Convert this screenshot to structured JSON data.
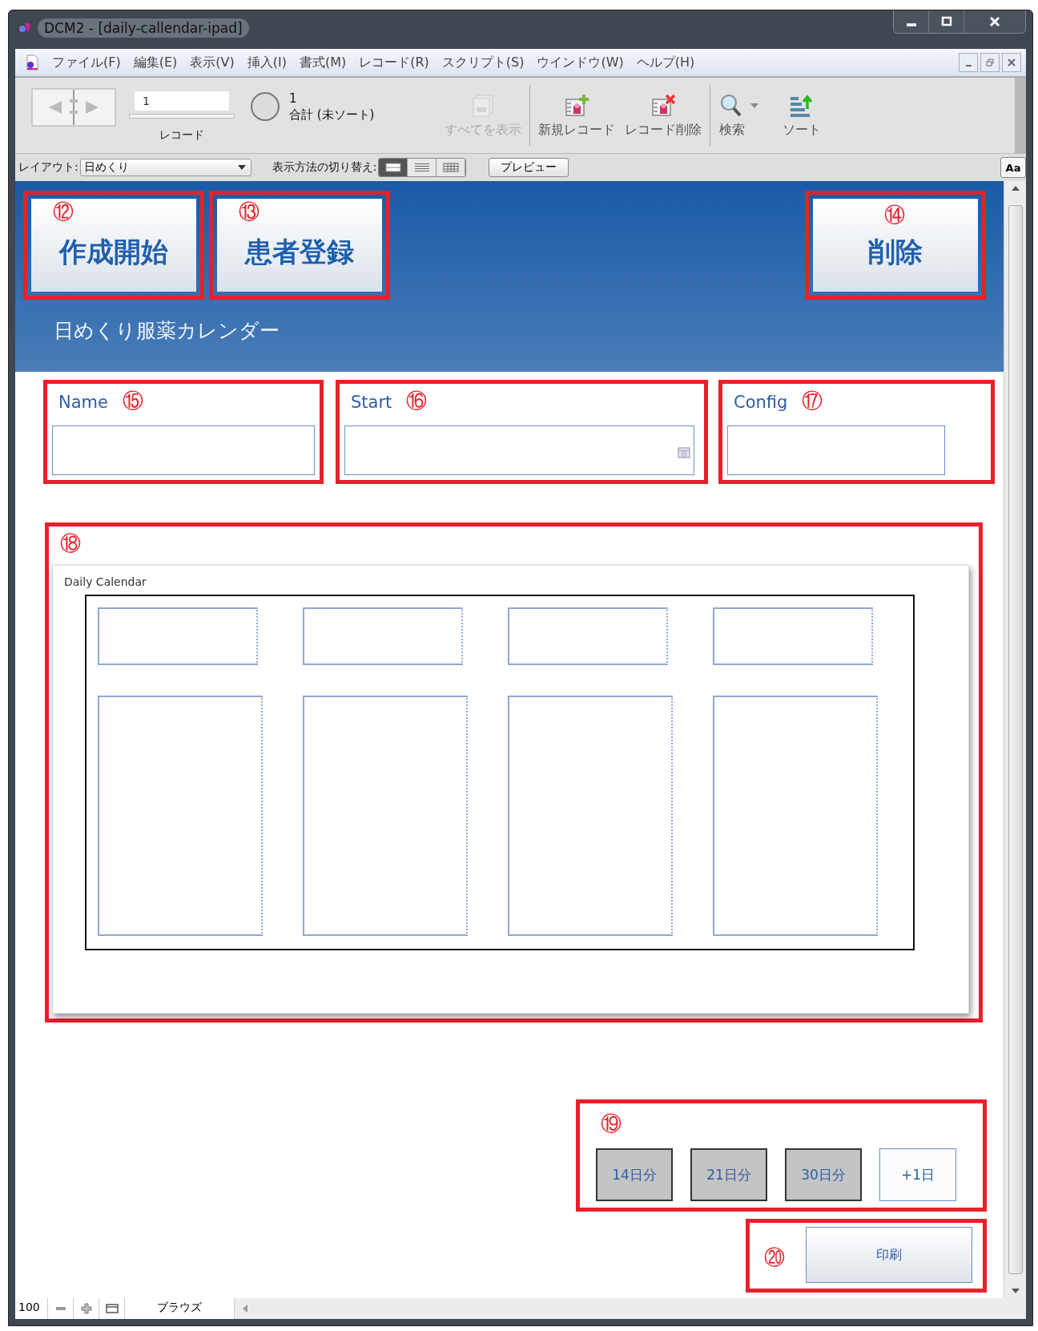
{
  "window": {
    "title": "DCM2 - [daily-callendar-ipad]"
  },
  "menu": [
    "ファイル(F)",
    "編集(E)",
    "表示(V)",
    "挿入(I)",
    "書式(M)",
    "レコード(R)",
    "スクリプト(S)",
    "ウインドウ(W)",
    "ヘルプ(H)"
  ],
  "toolbar": {
    "record_value": "1",
    "record_label": "レコード",
    "found": "1",
    "total_label": "合計 (未ソート)",
    "buttons": [
      {
        "label": "すべてを表示",
        "kind": "showall",
        "disabled": true
      },
      {
        "label": "新規レコード",
        "kind": "new",
        "disabled": false
      },
      {
        "label": "レコード削除",
        "kind": "delete",
        "disabled": false
      },
      {
        "label": "検索",
        "kind": "find",
        "disabled": false
      },
      {
        "label": "ソート",
        "kind": "sort",
        "disabled": false
      }
    ]
  },
  "layout_bar": {
    "layout_label": "レイアウト:",
    "layout_value": "日めくり",
    "view_label": "表示方法の切り替え:",
    "views": [
      {
        "kind": "form",
        "selected": true
      },
      {
        "kind": "list",
        "selected": false
      },
      {
        "kind": "table",
        "selected": false
      }
    ],
    "preview": "プレビュー",
    "font_button": "Aa"
  },
  "header": {
    "buttons": [
      {
        "marker": "⑫",
        "label": "作成開始"
      },
      {
        "marker": "⑬",
        "label": "患者登録"
      },
      {
        "marker": "⑭",
        "label": "削除"
      }
    ],
    "subtitle": "日めくり服薬カレンダー"
  },
  "fields": [
    {
      "marker": "⑮",
      "label": "Name",
      "kind": "text"
    },
    {
      "marker": "⑯",
      "label": "Start",
      "kind": "date"
    },
    {
      "marker": "⑰",
      "label": "Config",
      "kind": "text"
    }
  ],
  "calendar": {
    "marker": "⑱",
    "title": "Daily Calendar"
  },
  "range_buttons": {
    "marker": "⑲",
    "buttons": [
      {
        "label": "14日分",
        "kind": "preset"
      },
      {
        "label": "21日分",
        "kind": "preset"
      },
      {
        "label": "30日分",
        "kind": "preset"
      },
      {
        "label": "+1日",
        "kind": "step"
      }
    ]
  },
  "print": {
    "marker": "⑳",
    "label": "印刷"
  },
  "status_bar": {
    "zoom": "100",
    "mode": "ブラウズ"
  }
}
